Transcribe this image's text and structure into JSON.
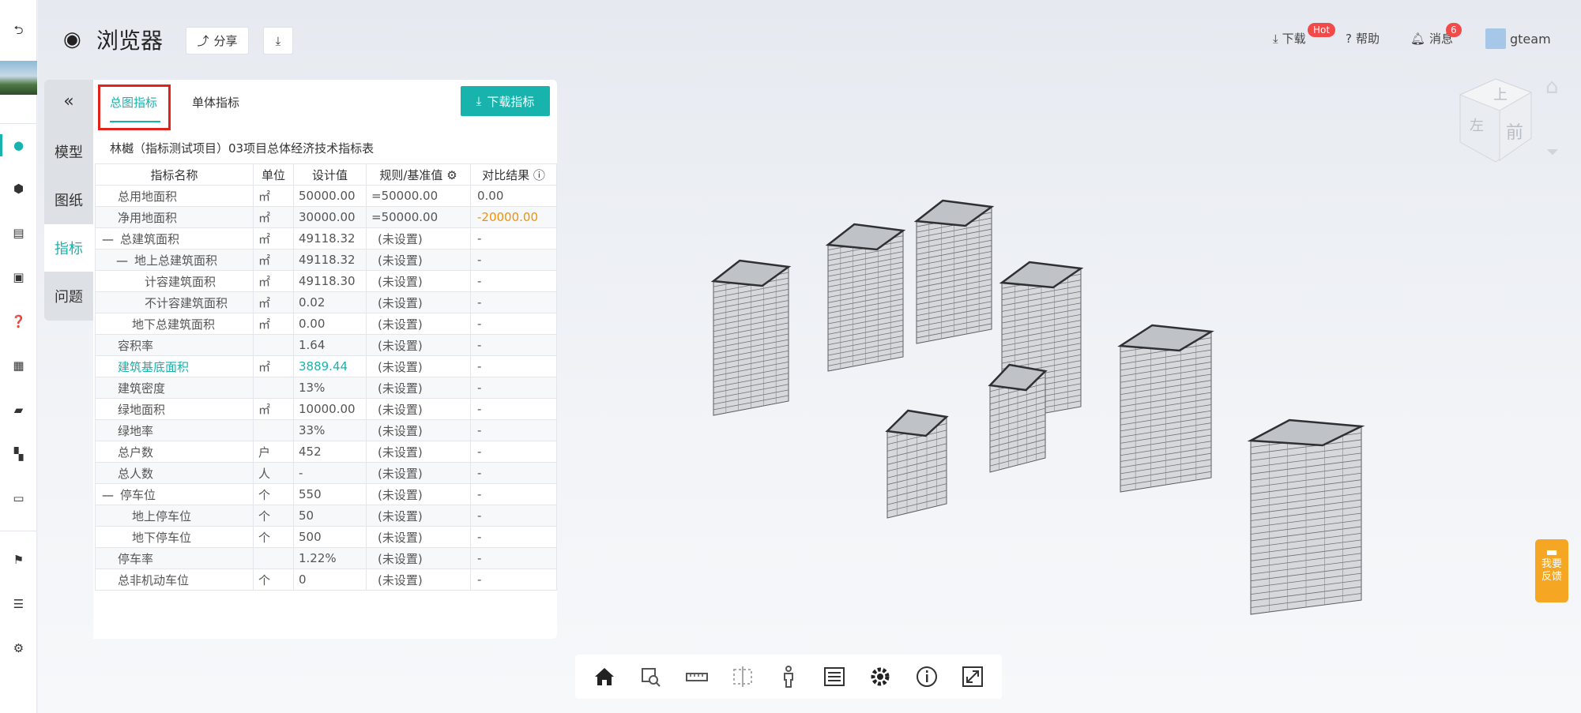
{
  "app": {
    "title": "浏览器"
  },
  "header": {
    "share_label": "分享",
    "download_label": "下载",
    "hot_badge": "Hot",
    "help_label": "帮助",
    "messages_label": "消息",
    "messages_count": "6",
    "username": "gteam"
  },
  "side_tabs": [
    "模型",
    "图纸",
    "指标",
    "问题"
  ],
  "panel": {
    "tab_total": "总图指标",
    "tab_single": "单体指标",
    "download_button": "下载指标",
    "table_title": "林樾（指标测试项目）03项目总体经济技术指标表",
    "columns": [
      "指标名称",
      "单位",
      "设计值",
      "规则/基准值",
      "对比结果"
    ],
    "rows": [
      {
        "name": "总用地面积",
        "unit": "㎡",
        "value": "50000.00",
        "rule": "=50000.00",
        "result": "0.00"
      },
      {
        "name": "净用地面积",
        "unit": "㎡",
        "value": "30000.00",
        "rule": "=50000.00",
        "result": "-20000.00"
      },
      {
        "name": "总建筑面积",
        "unit": "㎡",
        "value": "49118.32",
        "rule": "(未设置)",
        "result": "-",
        "collapse": "—"
      },
      {
        "name": "地上总建筑面积",
        "unit": "㎡",
        "value": "49118.32",
        "rule": "(未设置)",
        "result": "-",
        "collapse": "—"
      },
      {
        "name": "计容建筑面积",
        "unit": "㎡",
        "value": "49118.30",
        "rule": "(未设置)",
        "result": "-"
      },
      {
        "name": "不计容建筑面积",
        "unit": "㎡",
        "value": "0.02",
        "rule": "(未设置)",
        "result": "-"
      },
      {
        "name": "地下总建筑面积",
        "unit": "㎡",
        "value": "0.00",
        "rule": "(未设置)",
        "result": "-"
      },
      {
        "name": "容积率",
        "unit": "",
        "value": "1.64",
        "rule": "(未设置)",
        "result": "-"
      },
      {
        "name": "建筑基底面积",
        "unit": "㎡",
        "value": "3889.44",
        "rule": "(未设置)",
        "result": "-"
      },
      {
        "name": "建筑密度",
        "unit": "",
        "value": "13%",
        "rule": "(未设置)",
        "result": "-"
      },
      {
        "name": "绿地面积",
        "unit": "㎡",
        "value": "10000.00",
        "rule": "(未设置)",
        "result": "-"
      },
      {
        "name": "绿地率",
        "unit": "",
        "value": "33%",
        "rule": "(未设置)",
        "result": "-"
      },
      {
        "name": "总户数",
        "unit": "户",
        "value": "452",
        "rule": "(未设置)",
        "result": "-"
      },
      {
        "name": "总人数",
        "unit": "人",
        "value": "-",
        "rule": "(未设置)",
        "result": "-"
      },
      {
        "name": "停车位",
        "unit": "个",
        "value": "550",
        "rule": "(未设置)",
        "result": "-",
        "collapse": "—"
      },
      {
        "name": "地上停车位",
        "unit": "个",
        "value": "50",
        "rule": "(未设置)",
        "result": "-"
      },
      {
        "name": "地下停车位",
        "unit": "个",
        "value": "500",
        "rule": "(未设置)",
        "result": "-"
      },
      {
        "name": "停车率",
        "unit": "",
        "value": "1.22%",
        "rule": "(未设置)",
        "result": "-"
      },
      {
        "name": "总非机动车位",
        "unit": "个",
        "value": "0",
        "rule": "(未设置)",
        "result": "-"
      }
    ]
  },
  "viewcube": {
    "top": "上",
    "front": "前",
    "left": "左"
  },
  "feedback": {
    "line1": "我要",
    "line2": "反馈"
  },
  "colors": {
    "accent": "#18b3ac",
    "negative": "#f0900b",
    "badge": "#f24949",
    "feedback": "#f5a623"
  }
}
